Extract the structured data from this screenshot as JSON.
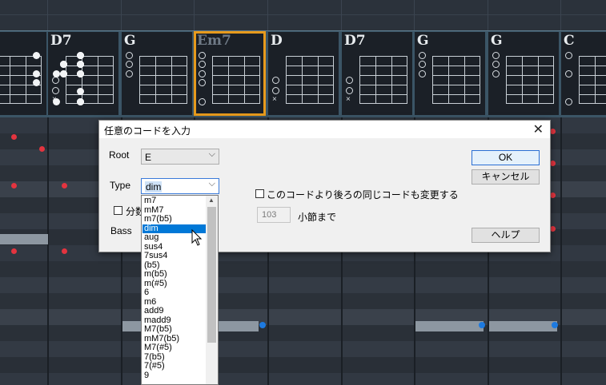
{
  "chords": [
    {
      "name": "",
      "selected": false
    },
    {
      "name": "D7",
      "selected": false
    },
    {
      "name": "G",
      "selected": false
    },
    {
      "name": "Em7",
      "selected": true
    },
    {
      "name": "D",
      "selected": false
    },
    {
      "name": "D7",
      "selected": false
    },
    {
      "name": "G",
      "selected": false
    },
    {
      "name": "G",
      "selected": false
    },
    {
      "name": "C",
      "selected": false
    }
  ],
  "dialog": {
    "title": "任意のコードを入力",
    "root_label": "Root",
    "root_value": "E",
    "type_label": "Type",
    "type_value": "dim",
    "split_label": "分数",
    "bass_label": "Bass",
    "change_following_label": "このコードより後ろの同じコードも変更する",
    "measure_value": "103",
    "measure_suffix": "小節まで",
    "ok_label": "OK",
    "cancel_label": "キャンセル",
    "help_label": "ヘルプ"
  },
  "type_options": [
    "m7",
    "mM7",
    "m7(b5)",
    "dim",
    "aug",
    "sus4",
    "7sus4",
    "(b5)",
    "m(b5)",
    "m(#5)",
    "6",
    "m6",
    "add9",
    "madd9",
    "M7(b5)",
    "mM7(b5)",
    "M7(#5)",
    "7(b5)",
    "7(#5)",
    "9"
  ],
  "type_selected_index": 3,
  "colors": {
    "accent_selected_chord": "#e79a1c",
    "list_highlight": "#0078d7",
    "note_red": "#e3343f",
    "note_blue": "#1d7ae0"
  }
}
